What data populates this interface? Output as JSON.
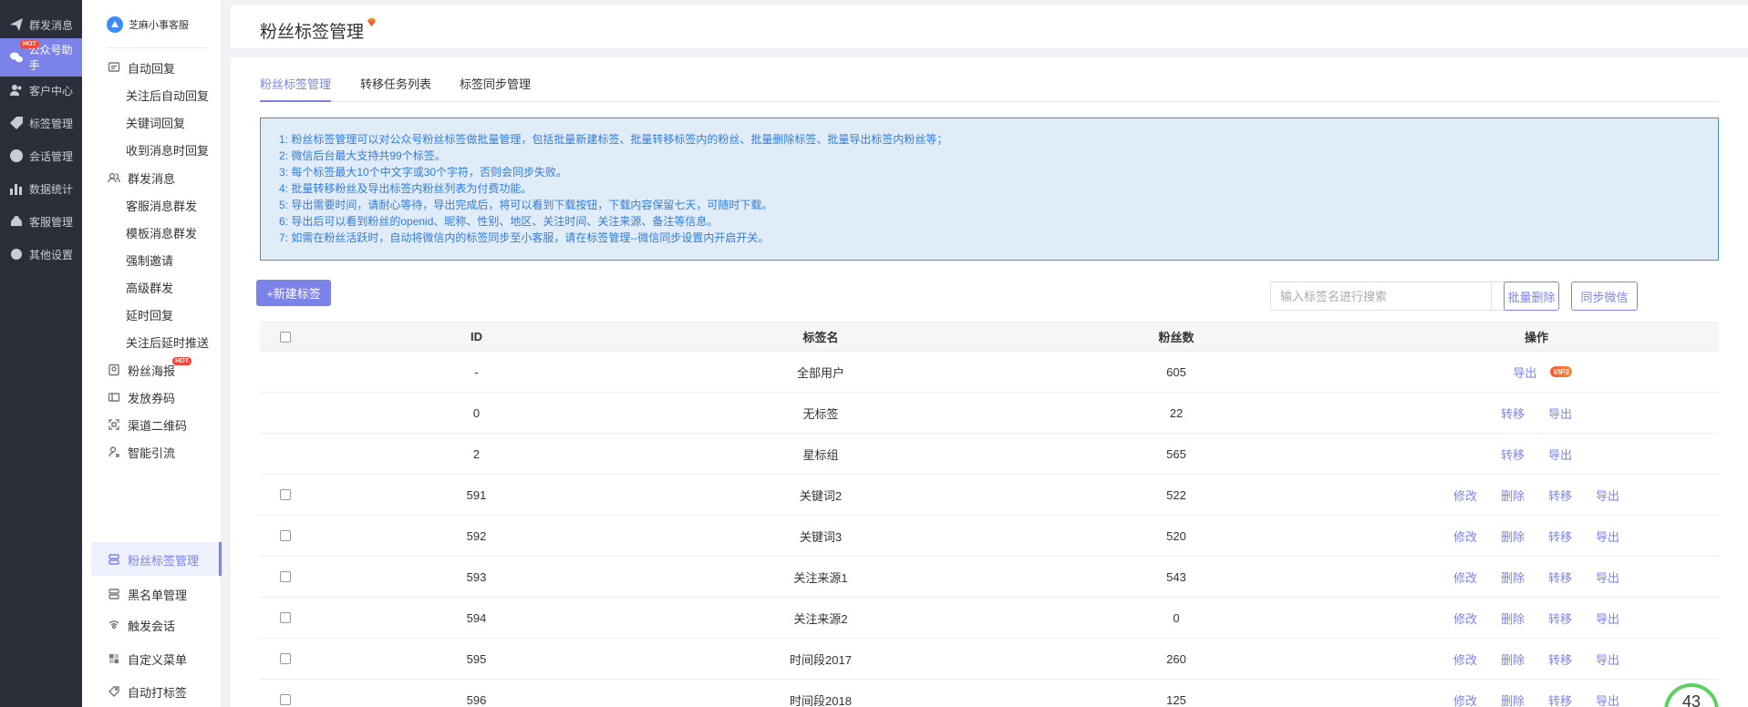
{
  "leftnav": [
    {
      "label": "群发消息",
      "icon": "send-icon"
    },
    {
      "label": "公众号助手",
      "icon": "wechat-icon",
      "badge": "HOT",
      "active": true
    },
    {
      "label": "客户中心",
      "icon": "users-icon"
    },
    {
      "label": "标签管理",
      "icon": "tag-icon"
    },
    {
      "label": "会话管理",
      "icon": "chat-icon"
    },
    {
      "label": "数据统计",
      "icon": "chart-icon"
    },
    {
      "label": "客服管理",
      "icon": "support-icon"
    },
    {
      "label": "其他设置",
      "icon": "gear-icon"
    }
  ],
  "brand": {
    "name": "芝麻小事客服"
  },
  "submenu": {
    "auto_reply": "自动回复",
    "follow_reply": "关注后自动回复",
    "keyword_reply": "关键词回复",
    "message_reply": "收到消息时回复",
    "mass_message": "群发消息",
    "cs_mass": "客服消息群发",
    "template_mass": "模板消息群发",
    "force_invite": "强制邀请",
    "advanced_mass": "高级群发",
    "delay_reply": "延时回复",
    "follow_delay_push": "关注后延时推送",
    "fan_poster": "粉丝海报",
    "fan_poster_badge": "HOT",
    "coupon": "发放券码",
    "channel_qr": "渠道二维码",
    "smart_guide": "智能引流",
    "fan_tag": "粉丝标签管理",
    "blacklist": "黑名单管理",
    "trigger_chat": "触发会话",
    "custom_menu": "自定义菜单",
    "auto_tag": "自动打标签"
  },
  "header": {
    "title": "粉丝标签管理"
  },
  "tabs": [
    "粉丝标签管理",
    "转移任务列表",
    "标签同步管理"
  ],
  "notice": [
    "1:  粉丝标签管理可以对公众号粉丝标签做批量管理，包括批量新建标签、批量转移标签内的粉丝、批量删除标签、批量导出标签内粉丝等；",
    "2:  微信后台最大支持共99个标签。",
    "3:  每个标签最大10个中文字或30个字符，否则会同步失败。",
    "4:  批量转移粉丝及导出标签内粉丝列表为付费功能。",
    "5:  导出需要时间，请耐心等待，导出完成后，将可以看到下载按钮，下载内容保留七天，可随时下载。",
    "6:  导出后可以看到粉丝的openid、昵称、性别、地区、关注时间、关注来源、备注等信息。",
    "7:  如需在粉丝活跃时，自动将微信内的标签同步至小客服，请在标签管理--微信同步设置内开启开关。"
  ],
  "toolbar": {
    "new_tag": "+新建标签",
    "search_placeholder": "输入标签名进行搜索",
    "batch_delete": "批量删除",
    "sync_wechat": "同步微信"
  },
  "table": {
    "headers": {
      "id": "ID",
      "name": "标签名",
      "fans": "粉丝数",
      "ops": "操作"
    },
    "rows": [
      {
        "id": "-",
        "name": "全部用户",
        "fans": "605",
        "ops": [
          "导出"
        ],
        "vip": "VIP3",
        "checkbox": false
      },
      {
        "id": "0",
        "name": "无标签",
        "fans": "22",
        "ops": [
          "转移",
          "导出"
        ],
        "checkbox": false
      },
      {
        "id": "2",
        "name": "星标组",
        "fans": "565",
        "ops": [
          "转移",
          "导出"
        ],
        "checkbox": false
      },
      {
        "id": "591",
        "name": "关键词2",
        "fans": "522",
        "ops": [
          "修改",
          "删除",
          "转移",
          "导出"
        ],
        "checkbox": true
      },
      {
        "id": "592",
        "name": "关键词3",
        "fans": "520",
        "ops": [
          "修改",
          "删除",
          "转移",
          "导出"
        ],
        "checkbox": true
      },
      {
        "id": "593",
        "name": "关注来源1",
        "fans": "543",
        "ops": [
          "修改",
          "删除",
          "转移",
          "导出"
        ],
        "checkbox": true
      },
      {
        "id": "594",
        "name": "关注来源2",
        "fans": "0",
        "ops": [
          "修改",
          "删除",
          "转移",
          "导出"
        ],
        "checkbox": true
      },
      {
        "id": "595",
        "name": "时间段2017",
        "fans": "260",
        "ops": [
          "修改",
          "删除",
          "转移",
          "导出"
        ],
        "checkbox": true
      },
      {
        "id": "596",
        "name": "时间段2018",
        "fans": "125",
        "ops": [
          "修改",
          "删除",
          "转移",
          "导出"
        ],
        "checkbox": true
      }
    ]
  },
  "gauge": {
    "value": "43"
  },
  "colors": {
    "accent": "#7b83eb",
    "nav_bg": "#2b2f3a",
    "notice_text": "#2d7de0",
    "notice_bg": "#e1ecf9"
  }
}
